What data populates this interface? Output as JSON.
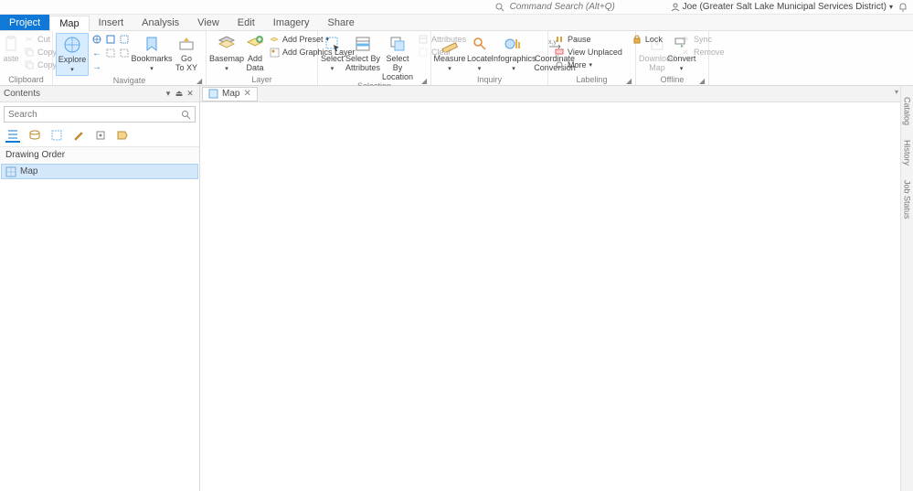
{
  "topbar": {
    "command_search_placeholder": "Command Search (Alt+Q)",
    "user": "Joe (Greater Salt Lake Municipal Services District)"
  },
  "tabs": {
    "project": "Project",
    "map": "Map",
    "insert": "Insert",
    "analysis": "Analysis",
    "view": "View",
    "edit": "Edit",
    "imagery": "Imagery",
    "share": "Share"
  },
  "ribbon": {
    "clipboard": {
      "label": "Clipboard",
      "paste": "aste",
      "cut": "Cut",
      "copy": "Copy",
      "copy_path": "Copy Path"
    },
    "navigate": {
      "label": "Navigate",
      "explore": "Explore",
      "bookmarks": "Bookmarks",
      "goto_xy": "Go\nTo XY"
    },
    "layer": {
      "label": "Layer",
      "basemap": "Basemap",
      "add_data": "Add\nData",
      "add_preset": "Add Preset",
      "add_graphics": "Add Graphics Layer"
    },
    "selection": {
      "label": "Selection",
      "select": "Select",
      "by_attr": "Select By\nAttributes",
      "by_loc": "Select By\nLocation",
      "attributes": "Attributes",
      "clear": "Clear"
    },
    "inquiry": {
      "label": "Inquiry",
      "measure": "Measure",
      "locate": "Locate",
      "infographics": "Infographics",
      "coord": "Coordinate\nConversion"
    },
    "labeling": {
      "label": "Labeling",
      "convert": "Convert",
      "pause": "Pause",
      "lock": "Lock",
      "view_unplaced": "View Unplaced",
      "more": "More"
    },
    "offline": {
      "label": "Offline",
      "download_map": "Download\nMap",
      "sync": "Sync",
      "remove": "Remove"
    }
  },
  "contents": {
    "title": "Contents",
    "search_placeholder": "Search",
    "section": "Drawing Order",
    "layer": "Map"
  },
  "view": {
    "tab": "Map"
  },
  "side": {
    "catalog": "Catalog",
    "history": "History",
    "jobstatus": "Job Status"
  }
}
